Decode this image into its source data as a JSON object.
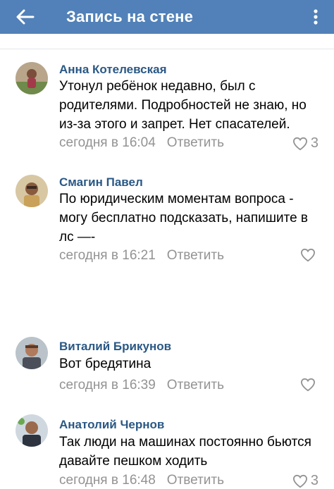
{
  "header": {
    "title": "Запись на стене"
  },
  "comments": [
    {
      "author": "Анна Котелевская",
      "text": "Утонул ребёнок недавно, был с родителями. Подробностей не знаю, но из-за этого и запрет. Нет спасателей.",
      "time": "сегодня в 16:04",
      "reply": "Ответить",
      "likes": "3"
    },
    {
      "author": "Смагин Павел",
      "text": "По юридическим моментам вопроса - могу бесплатно подсказать, напишите в лс —-",
      "time": "сегодня в 16:21",
      "reply": "Ответить",
      "likes": ""
    },
    {
      "author": "Виталий Брикунов",
      "text": "Вот бредятина",
      "time": "сегодня в 16:39",
      "reply": "Ответить",
      "likes": ""
    },
    {
      "author": "Анатолий Чернов",
      "text": "Так люди на машинах постоянно бьются давайте пешком ходить",
      "time": "сегодня в 16:48",
      "reply": "Ответить",
      "likes": "3"
    }
  ],
  "icons": {
    "back": "arrow-left-icon",
    "more": "more-vertical-icon",
    "like": "heart-outline-icon"
  },
  "colors": {
    "appbar": "#5181b8",
    "author": "#2a5885",
    "meta": "#939393"
  }
}
